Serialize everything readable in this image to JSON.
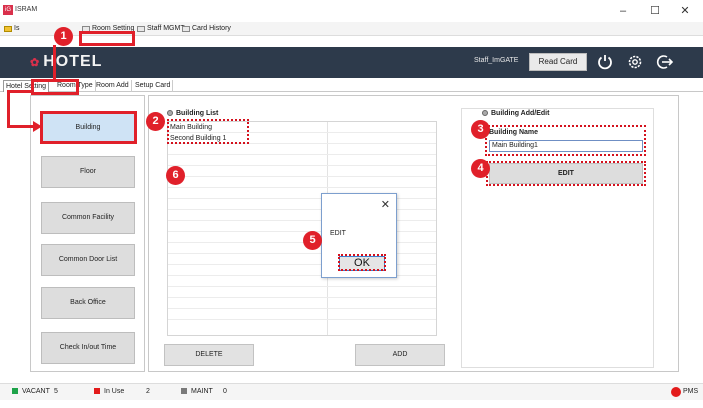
{
  "window": {
    "title": "ISRAM",
    "minimize": "–",
    "maximize": "☐",
    "close": "✕"
  },
  "menubar": {
    "items": [
      {
        "label": "Is"
      },
      {
        "label": "Room Setting"
      },
      {
        "label": "Staff MGMT"
      },
      {
        "label": "Card History"
      }
    ]
  },
  "navbar": {
    "logo": "HOTEL",
    "staff_name": "Staff_ImGATE",
    "read_card": "Read Card"
  },
  "tabs": [
    {
      "label": "Hotel Setting"
    },
    {
      "label": "Room Type"
    },
    {
      "label": "Room Add"
    },
    {
      "label": "Setup Card"
    }
  ],
  "sidebar": {
    "items": [
      {
        "label": "Building"
      },
      {
        "label": "Floor"
      },
      {
        "label": "Common Facility"
      },
      {
        "label": "Common Door List"
      },
      {
        "label": "Back Office"
      },
      {
        "label": "Check In/out Time"
      }
    ]
  },
  "building_list": {
    "title": "Building List",
    "items": [
      "Main Building",
      "Second Building 1"
    ],
    "delete_label": "DELETE",
    "add_label": "ADD"
  },
  "building_edit": {
    "title": "Building Add/Edit",
    "name_label": "Building Name",
    "name_value": "Main Building1",
    "edit_label": "EDIT"
  },
  "dialog": {
    "message": "EDIT",
    "ok_label": "OK",
    "close": "✕"
  },
  "status": {
    "vacant_label": "VACANT",
    "vacant_count": "5",
    "in_use_label": "In Use",
    "in_use_count": "2",
    "maint_label": "MAINT",
    "maint_count": "0",
    "pms_label": "PMS"
  },
  "badges": [
    "1",
    "2",
    "3",
    "4",
    "5",
    "6"
  ],
  "colors": {
    "navbar": "#2d3a4b",
    "accent_red": "#e0202a",
    "vacant": "#1ea34a",
    "in_use": "#e31b1b",
    "maint": "#7a7a7a"
  }
}
